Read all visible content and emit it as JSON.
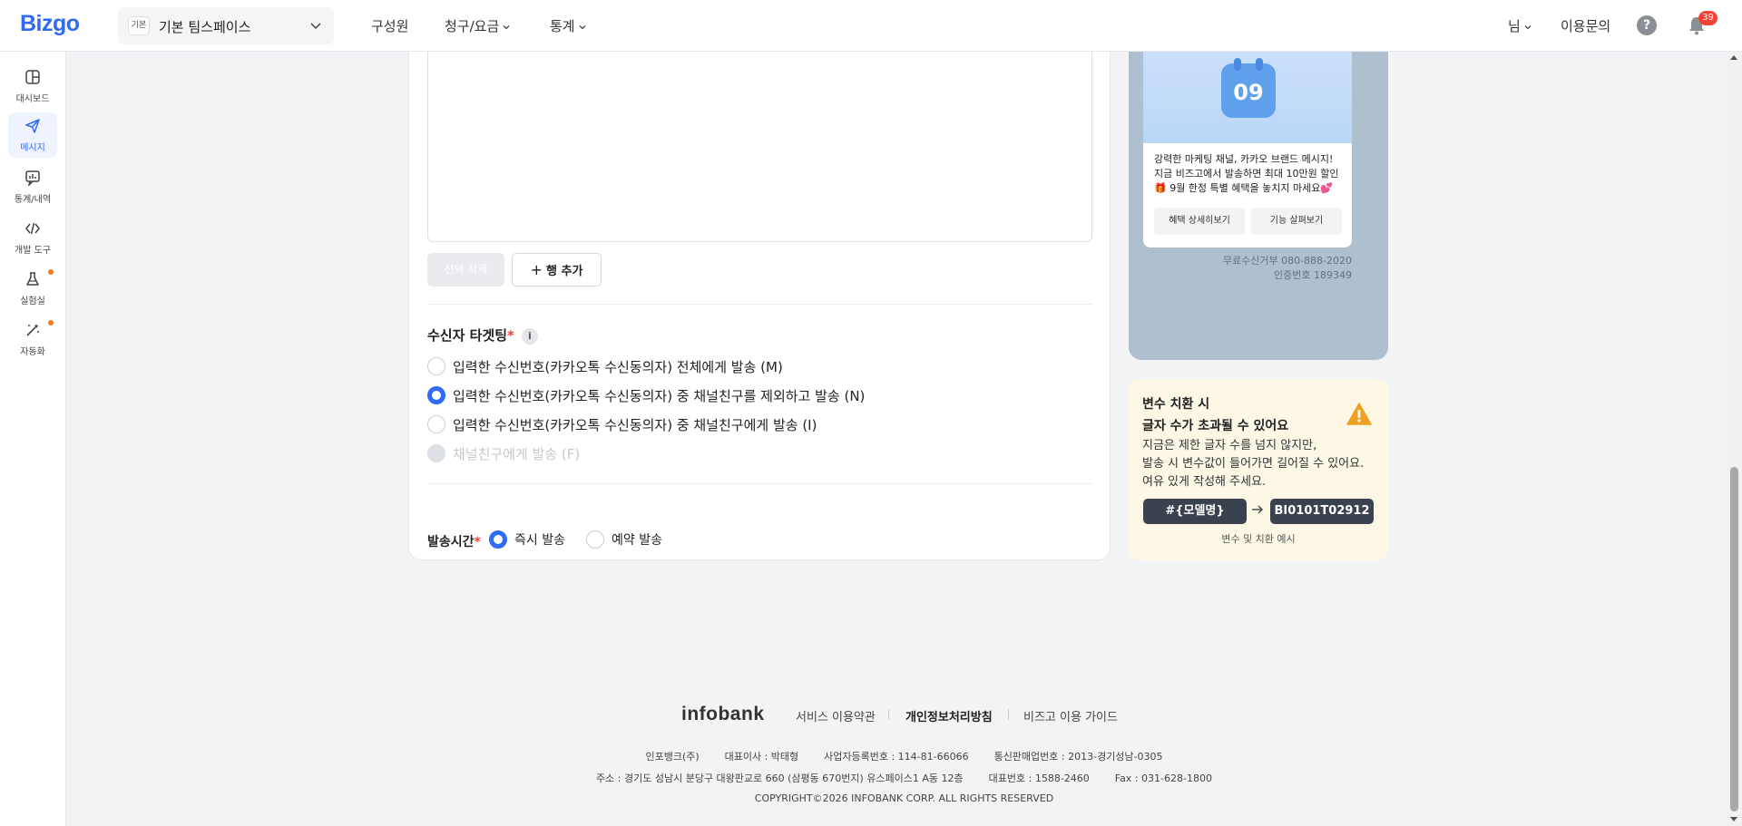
{
  "header": {
    "logo": "Bizgo",
    "workspace_badge": "기본",
    "workspace_name": "기본 팀스페이스",
    "nav": [
      "구성원",
      "청구/요금",
      "통계"
    ],
    "user": "님",
    "inquiry": "이용문의",
    "help": "?",
    "notification_count": "39"
  },
  "sidebar": {
    "items": [
      {
        "label": "대시보드",
        "icon": "dashboard-icon"
      },
      {
        "label": "메시지",
        "icon": "send-icon",
        "active": true
      },
      {
        "label": "통계/내역",
        "icon": "stats-icon"
      },
      {
        "label": "개발 도구",
        "icon": "code-icon"
      },
      {
        "label": "실험실",
        "icon": "flask-icon",
        "dot": true
      },
      {
        "label": "자동화",
        "icon": "magic-wand-icon",
        "dot": true
      }
    ]
  },
  "form": {
    "delete_selected": "선택 삭제",
    "add_row": "행 추가",
    "targeting_title": "수신자 타겟팅",
    "required_mark": "*",
    "info": "i",
    "targeting_options": [
      {
        "label": "입력한 수신번호(카카오톡 수신동의자) 전체에게 발송 (M)",
        "state": "unchecked"
      },
      {
        "label": "입력한 수신번호(카카오톡 수신동의자) 중 채널친구를 제외하고 발송 (N)",
        "state": "checked"
      },
      {
        "label": "입력한 수신번호(카카오톡 수신동의자) 중 채널친구에게 발송 (I)",
        "state": "unchecked"
      },
      {
        "label": "채널친구에게 발송 (F)",
        "state": "disabled"
      }
    ],
    "send_time_label": "발송시간",
    "send_time_options": [
      {
        "label": "즉시 발송",
        "state": "checked"
      },
      {
        "label": "예약 발송",
        "state": "unchecked"
      }
    ]
  },
  "preview": {
    "calendar_number": "09",
    "ad_lines": [
      "강력한 마케팅 채널, 카카오 브랜드 메시지!",
      "지금 비즈고에서 발송하면 최대 10만원 할인",
      "🎁 9월 한정 특별 혜택을 놓치지 마세요💕"
    ],
    "ad_buttons": [
      "혜택 상세히보기",
      "기능 살펴보기"
    ],
    "footer_lines": [
      "무료수신거부 080-888-2020",
      "인증번호 189349"
    ]
  },
  "notice": {
    "title_lines": [
      "변수 치환 시",
      "글자 수가 초과될 수 있어요"
    ],
    "body_lines": [
      "지금은 제한 글자 수를 넘지 않지만,",
      "발송 시 변수값이 들어가면 길어질 수 있어요.",
      "여유 있게 작성해 주세요."
    ],
    "variable_chip": "#{모델명}",
    "value_chip": "BI0101T02912",
    "caption": "변수 및 치환 예시"
  },
  "footer": {
    "logo": "infobank",
    "links": [
      "서비스 이용약관",
      "개인정보처리방침",
      "비즈고 이용 가이드"
    ],
    "line1": "인포뱅크(주)        대표이사 : 박태형        사업자등록번호 : 114-81-66066        통신판매업번호 : 2013-경기성남-0305",
    "line2": "주소 : 경기도 성남시 분당구 대왕판교로 660 (삼평동 670번지) 유스페이스1 A동 12층        대표번호 : 1588-2460        Fax : 031-628-1800",
    "line3": "COPYRIGHT©2026 INFOBANK CORP. ALL RIGHTS RESERVED"
  },
  "colors": {
    "accent": "#2f6bf5",
    "required": "#f44336",
    "badge": "#f44336",
    "sidebar_dot": "#ff7a1a",
    "preview_bg": "#aebfcf",
    "notice_bg": "#fdf8e6",
    "warning": "#f0a020"
  }
}
